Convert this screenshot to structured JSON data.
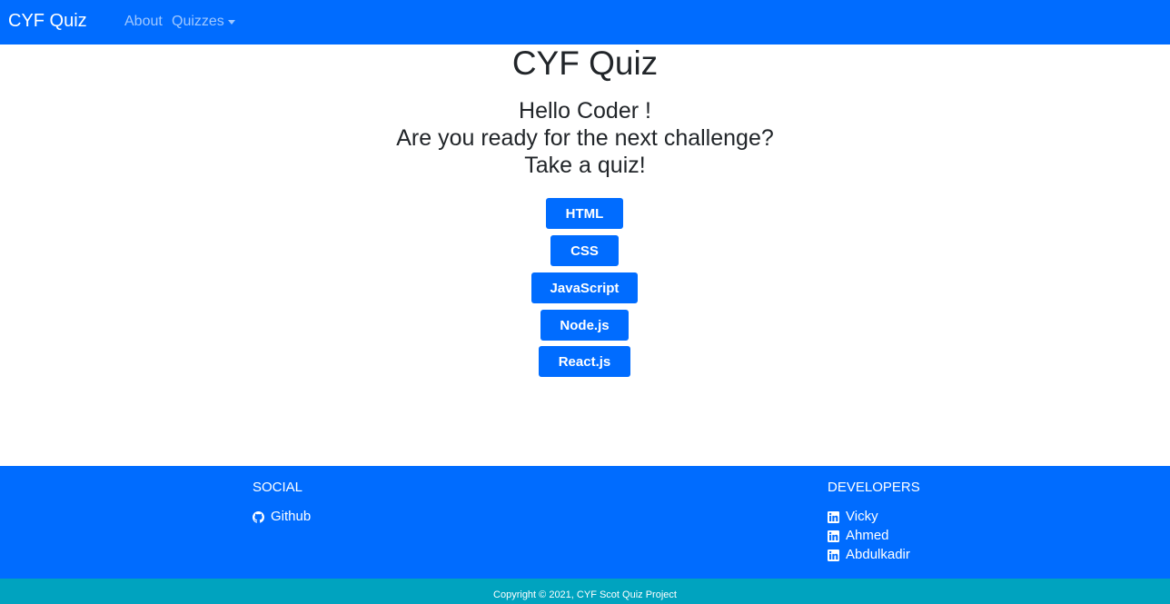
{
  "navbar": {
    "brand": "CYF Quiz",
    "links": {
      "about": "About",
      "quizzes": "Quizzes"
    }
  },
  "main": {
    "title": "CYF Quiz",
    "greeting_lines": [
      "Hello Coder !",
      "Are you ready for the next challenge?",
      "Take a quiz!"
    ],
    "quiz_buttons": [
      "HTML",
      "CSS",
      "JavaScript",
      "Node.js",
      "React.js"
    ]
  },
  "footer": {
    "social": {
      "heading": "SOCIAL",
      "links": [
        {
          "label": "Github",
          "icon": "github-icon"
        }
      ]
    },
    "developers": {
      "heading": "DEVELOPERS",
      "links": [
        {
          "label": "Vicky",
          "icon": "linkedin-icon"
        },
        {
          "label": "Ahmed",
          "icon": "linkedin-icon"
        },
        {
          "label": "Abdulkadir",
          "icon": "linkedin-icon"
        }
      ]
    },
    "copyright": "Copyright © 2021, CYF Scot Quiz Project"
  },
  "colors": {
    "primary": "#006cff",
    "copyright_bar": "#00a3bf",
    "text": "#212529"
  }
}
